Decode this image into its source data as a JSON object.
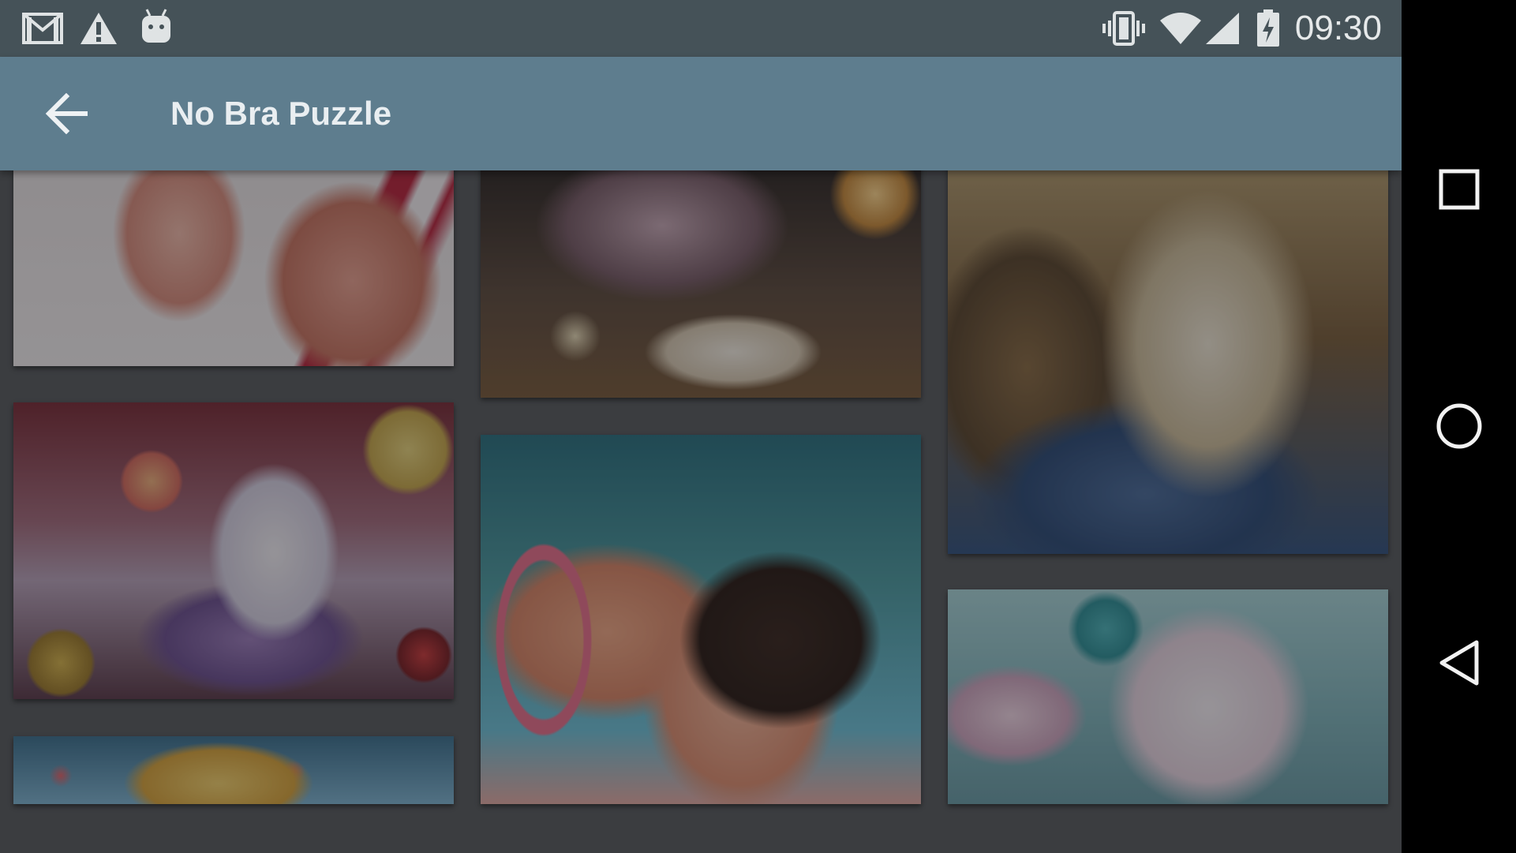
{
  "status_bar": {
    "time": "09:30",
    "icons": [
      "gmail-icon",
      "warning-icon",
      "android-icon",
      "vibrate-icon",
      "wifi-icon",
      "signal-icon",
      "battery-charging-icon"
    ]
  },
  "app_bar": {
    "title": "No Bra Puzzle",
    "back_icon": "arrow-back-icon"
  },
  "gallery": {
    "items": [
      {
        "name": "puzzle-image-1",
        "palette": [
          "#e6c8c2",
          "#b84a4f",
          "#f2eaea"
        ]
      },
      {
        "name": "puzzle-image-2",
        "palette": [
          "#4a3a34",
          "#c9a06a",
          "#e9dcc7"
        ]
      },
      {
        "name": "puzzle-image-3",
        "palette": [
          "#6e5a3a",
          "#c8b38b",
          "#3d5b80"
        ]
      },
      {
        "name": "puzzle-image-4",
        "palette": [
          "#6f4a56",
          "#d9c7d6",
          "#c2a34c"
        ]
      },
      {
        "name": "puzzle-image-5",
        "palette": [
          "#3d6f6c",
          "#e9a48c",
          "#3b2a22"
        ]
      },
      {
        "name": "puzzle-image-6",
        "palette": [
          "#5e8b8c",
          "#e9e0ea",
          "#d2a7b8"
        ]
      },
      {
        "name": "puzzle-image-7",
        "palette": [
          "#4f7c8f",
          "#e1c16e",
          "#d7665e"
        ]
      }
    ]
  },
  "nav_bar": {
    "recents_icon": "square-icon",
    "home_icon": "circle-icon",
    "back_icon": "triangle-back-icon"
  }
}
